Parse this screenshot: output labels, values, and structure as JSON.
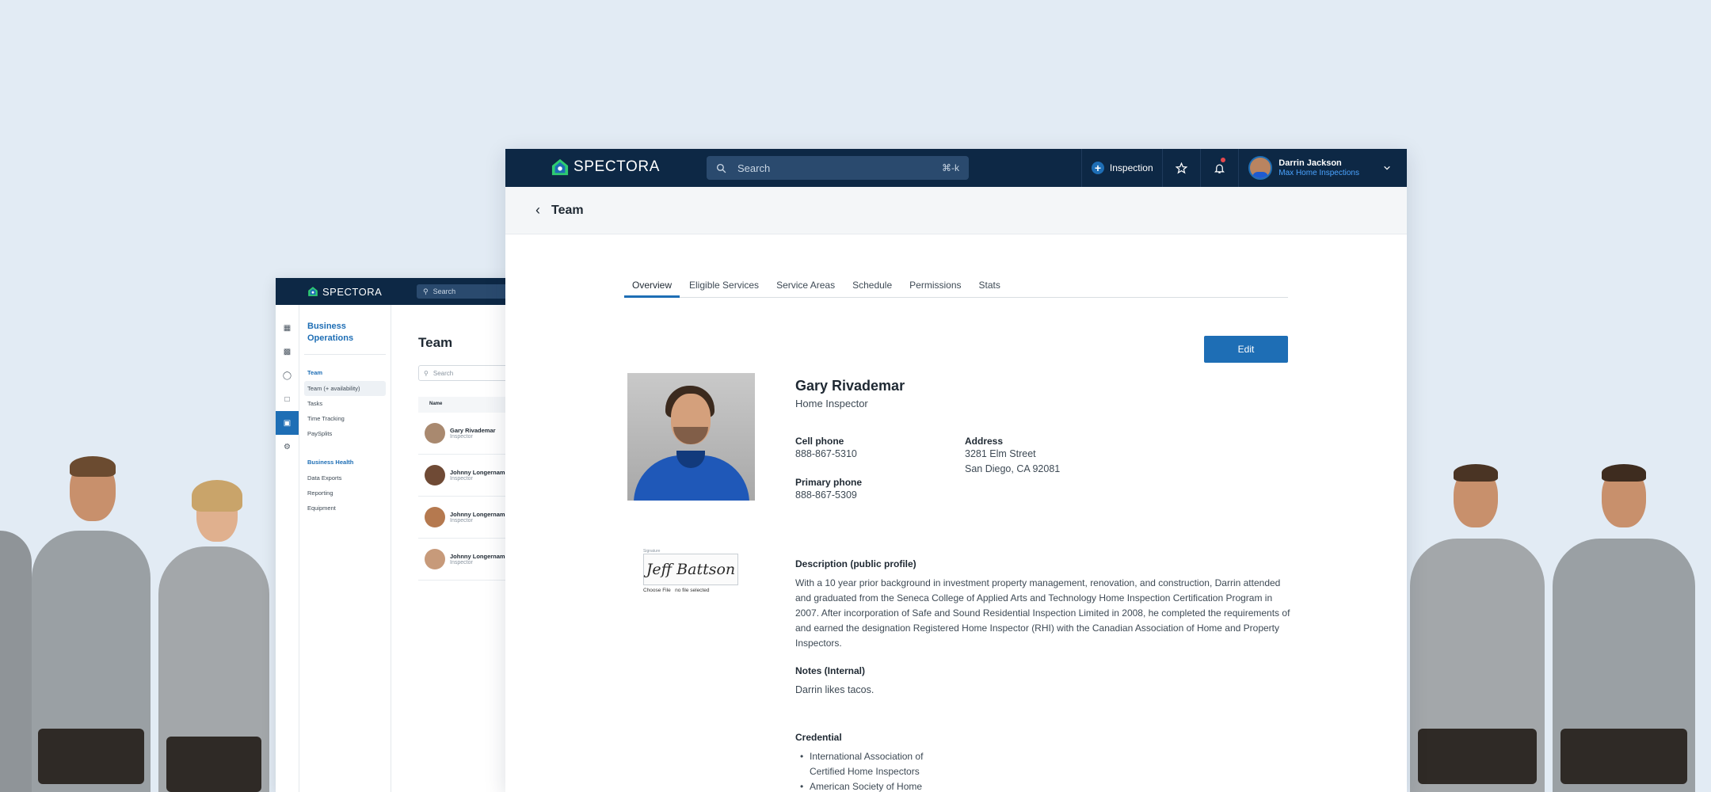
{
  "brand": "SPECTORA",
  "header": {
    "search_placeholder": "Search",
    "search_shortcut": "⌘-k",
    "inspection_button": "Inspection",
    "user_name": "Darrin Jackson",
    "user_company": "Max Home Inspections"
  },
  "page": {
    "back_title": "Team"
  },
  "tabs": [
    "Overview",
    "Eligible Services",
    "Service Areas",
    "Schedule",
    "Permissions",
    "Stats"
  ],
  "actions": {
    "edit": "Edit"
  },
  "profile": {
    "name": "Gary Rivademar",
    "role": "Home Inspector",
    "cell_label": "Cell phone",
    "cell": "888-867-5310",
    "primary_label": "Primary phone",
    "primary": "888-867-5309",
    "address_label": "Address",
    "address_line1": "3281 Elm Street",
    "address_line2": "San Diego, CA 92081",
    "description_label": "Description (public profile)",
    "description": "With a 10 year prior background in investment property management, renovation, and construction, Darrin attended and graduated from the Seneca College of Applied Arts and Technology Home Inspection Certification Program in 2007. After incorporation of Safe and Sound Residential Inspection Limited in 2008, he completed the requirements of and earned the designation Registered Home Inspector (RHI) with the Canadian Association of Home and Property Inspectors.",
    "notes_label": "Notes (Internal)",
    "notes": "Darrin  likes tacos.",
    "credential_label": "Credential",
    "credentials": [
      "International Association of Certified Home Inspectors",
      "American Society of Home"
    ]
  },
  "signature": {
    "caption": "Signature",
    "text": "Jeff Battson",
    "file_button": "Choose File",
    "file_status": "no file selected"
  },
  "back_window": {
    "brand": "SPECTORA",
    "search": "Search",
    "section": "Business Operations",
    "nav_heading": "Team",
    "nav": [
      "Team (+ availability)",
      "Tasks",
      "Time Tracking",
      "PaySplits"
    ],
    "health_heading": "Business Health",
    "health": [
      "Data Exports",
      "Reporting",
      "Equipment"
    ],
    "title": "Team",
    "list_search": "Search",
    "col_name": "Name",
    "rows": [
      {
        "name": "Gary Rivademar",
        "role": "Inspector"
      },
      {
        "name": "Johnny Longername",
        "role": "Inspector"
      },
      {
        "name": "Johnny Longername",
        "role": "Inspector"
      },
      {
        "name": "Johnny Longername",
        "role": "Inspector"
      }
    ]
  },
  "colors": {
    "navy": "#0d2845",
    "accent": "#1e6eb5",
    "background": "#e2ebf4"
  }
}
